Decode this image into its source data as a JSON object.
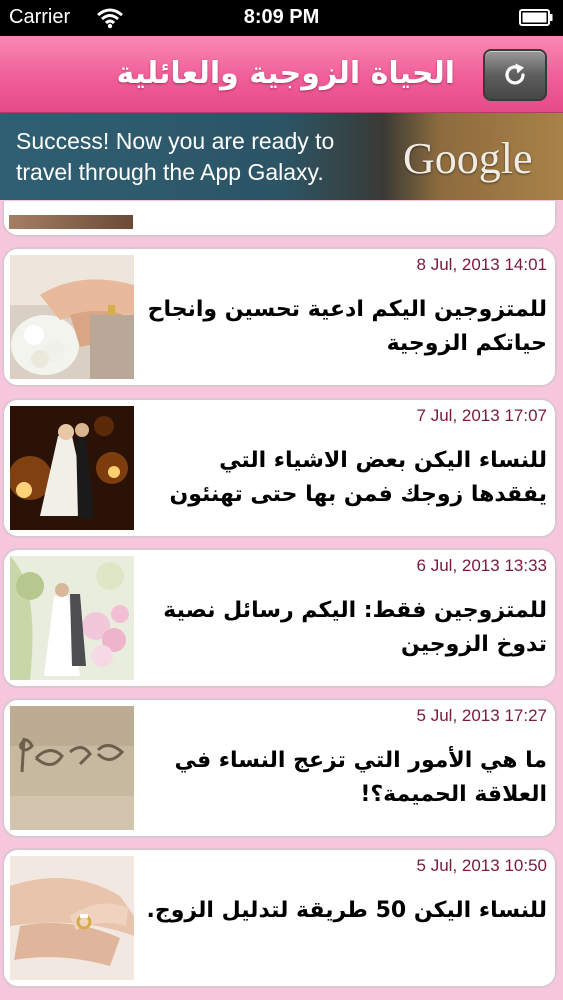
{
  "status_bar": {
    "carrier": "Carrier",
    "time": "8:09 PM",
    "wifi_icon": "wifi-icon",
    "battery_icon": "battery-icon"
  },
  "nav": {
    "title": "الحياة الزوجية والعائلية",
    "refresh_icon": "refresh-icon"
  },
  "ad": {
    "text": "Success! Now you are ready to travel through the App Galaxy.",
    "logo_text": "Google"
  },
  "articles": [
    {
      "date": "8 Jul, 2013 14:01",
      "title": "للمتزوجين اليكم ادعية تحسين وانجاح حياتكم الزوجية"
    },
    {
      "date": "7 Jul, 2013 17:07",
      "title": "للنساء اليكن بعض الاشياء التي يفقدها زوجك فمن بها حتى تهنئون"
    },
    {
      "date": "6 Jul, 2013 13:33",
      "title": "للمتزوجين فقط: اليكم رسائل نصية تدوخ الزوجين"
    },
    {
      "date": "5 Jul, 2013 17:27",
      "title": "ما هي الأمور التي تزعج النساء في العلاقة الحميمة؟!"
    },
    {
      "date": "5 Jul, 2013 10:50",
      "title": "للنساء اليكن 50 طريقة لتدليل الزوج."
    }
  ],
  "colors": {
    "nav_pink": "#f05e98",
    "background_pink": "#f6c6dd",
    "date_color": "#7a1a3c"
  }
}
